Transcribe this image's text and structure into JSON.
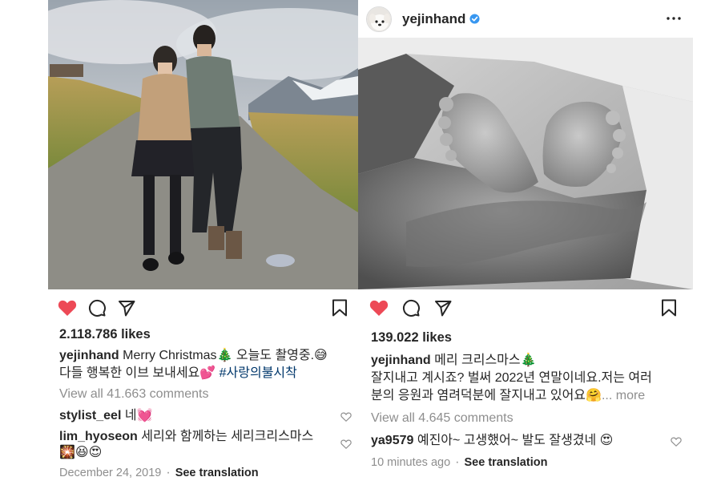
{
  "left_post": {
    "likes": "2.118.786 likes",
    "caption": {
      "username": "yejinhand",
      "line1": "Merry Christmas🎄 오늘도 촬영중.😅",
      "line2_text": "다들 행복한 이브 보내세요💕",
      "hashtag": "#사랑의불시착"
    },
    "view_comments": "View all 41.663 comments",
    "comments": [
      {
        "username": "stylist_eel",
        "text": "네💓"
      },
      {
        "username": "lim_hyoseon",
        "text": "세리와 함께하는 세리크리스마스",
        "text2": "🎇😆😍"
      }
    ],
    "date": "December 24, 2019",
    "see_translation": "See translation",
    "photo": {
      "desc_icon": "couple-mountain-photo",
      "sky": "#b8bec6",
      "ground": "#8f8e86"
    }
  },
  "right_post": {
    "header": {
      "username": "yejinhand",
      "verified_icon": "verified-badge-icon"
    },
    "likes": "139.022 likes",
    "caption": {
      "username": "yejinhand",
      "line1": "메리 크리스마스🎄",
      "line2": "잘지내고 계시죠? 벌써 2022년 연말이네요.저는 여러",
      "line3": "분의 응원과 염려덕분에 잘지내고 있어요🤗",
      "more": "... more"
    },
    "view_comments": "View all 4.645 comments",
    "comments": [
      {
        "username": "ya9579",
        "text": "예진아~ 고생했어~ 발도 잘생겼네 😍"
      }
    ],
    "time": "10 minutes ago",
    "see_translation": "See translation",
    "photo": {
      "desc_icon": "baby-feet-photo"
    }
  },
  "colors": {
    "like_red": "#ed4956",
    "text": "#262626",
    "muted": "#8e8e8e",
    "link": "#00376b",
    "verified": "#3897f0"
  }
}
